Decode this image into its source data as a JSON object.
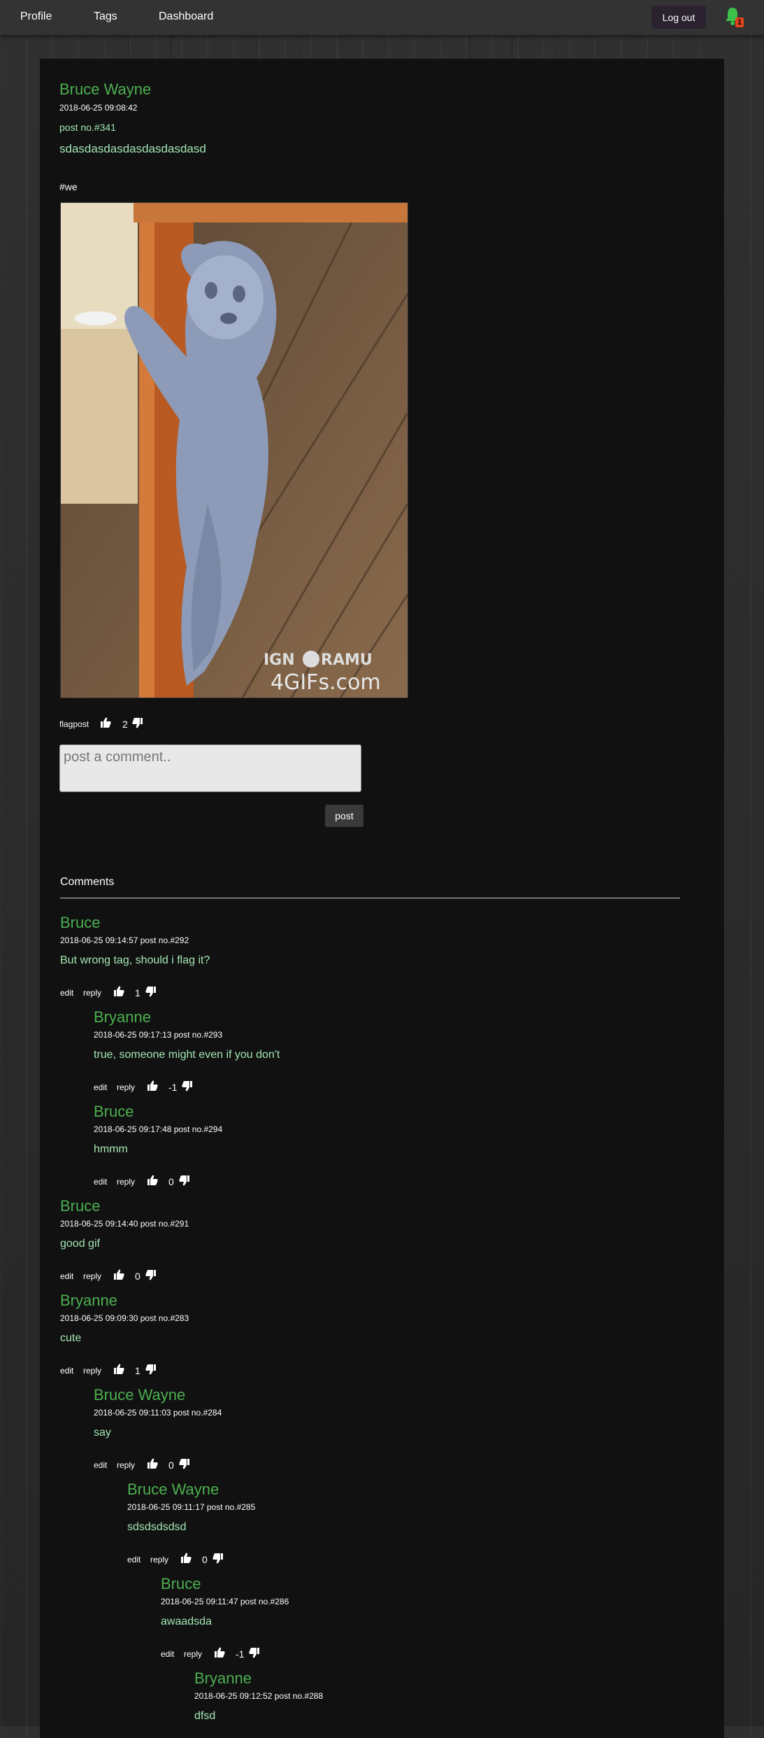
{
  "nav": {
    "links": [
      "Profile",
      "Tags",
      "Dashboard"
    ],
    "logout_label": "Log out",
    "notification_count": "1"
  },
  "post": {
    "author": "Bruce Wayne",
    "timestamp": "2018-06-25 09:08:42",
    "post_number": "post no.#341",
    "body": "sdasdasdasdasdasdasdasd",
    "tag": "#we",
    "image_watermark": "IGNORAMUS 4GIFs.com",
    "flag_label": "flagpost",
    "score": "2"
  },
  "comment_form": {
    "placeholder": "post a comment..",
    "submit_label": "post"
  },
  "comments_heading": "Comments",
  "comments": [
    {
      "author": "Bruce",
      "meta": "2018-06-25 09:14:57 post no.#292",
      "text": "But wrong tag, should i flag it?",
      "score": "1",
      "edit": "edit",
      "reply": "reply",
      "depth": 0
    },
    {
      "author": "Bryanne",
      "meta": "2018-06-25 09:17:13 post no.#293",
      "text": "true, someone might even if you don't",
      "score": "-1",
      "edit": "edit",
      "reply": "reply",
      "depth": 1
    },
    {
      "author": "Bruce",
      "meta": "2018-06-25 09:17:48 post no.#294",
      "text": "hmmm",
      "score": "0",
      "edit": "edit",
      "reply": "reply",
      "depth": 1
    },
    {
      "author": "Bruce",
      "meta": "2018-06-25 09:14:40 post no.#291",
      "text": "good gif",
      "score": "0",
      "edit": "edit",
      "reply": "reply",
      "depth": 0
    },
    {
      "author": "Bryanne",
      "meta": "2018-06-25 09:09:30 post no.#283",
      "text": "cute",
      "score": "1",
      "edit": "edit",
      "reply": "reply",
      "depth": 0
    },
    {
      "author": "Bruce Wayne",
      "meta": "2018-06-25 09:11:03 post no.#284",
      "text": "say",
      "score": "0",
      "edit": "edit",
      "reply": "reply",
      "depth": 1
    },
    {
      "author": "Bruce Wayne",
      "meta": "2018-06-25 09:11:17 post no.#285",
      "text": "sdsdsdsdsd",
      "score": "0",
      "edit": "edit",
      "reply": "reply",
      "depth": 2
    },
    {
      "author": "Bruce",
      "meta": "2018-06-25 09:11:47 post no.#286",
      "text": "awaadsda",
      "score": "-1",
      "edit": "edit",
      "reply": "reply",
      "depth": 3
    },
    {
      "author": "Bryanne",
      "meta": "2018-06-25 09:12:52 post no.#288",
      "text": "dfsd",
      "score": "",
      "edit": "",
      "reply": "",
      "depth": 4
    }
  ]
}
